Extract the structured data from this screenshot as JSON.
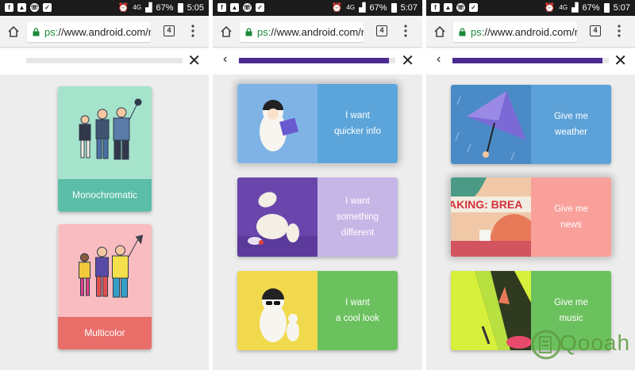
{
  "screens": [
    {
      "status": {
        "icons": [
          "facebook-icon",
          "gallery-icon",
          "whatsapp-icon",
          "clipboard-icon"
        ],
        "network": "4G",
        "battery": "67%",
        "time": "5:05"
      },
      "browser": {
        "scheme": "ps:",
        "url": "//www.android.com/r",
        "tabs": "4"
      },
      "progress": 0.0,
      "show_back": false,
      "cards": [
        {
          "label": "Monochromatic",
          "label_color": "#5bbea8",
          "art_color": "#a6e3cc"
        },
        {
          "label": "Multicolor",
          "label_color": "#e96e6a",
          "art_color": "#f8bcc1"
        }
      ]
    },
    {
      "status": {
        "icons": [
          "facebook-icon",
          "gallery-icon",
          "whatsapp-icon",
          "clipboard-icon"
        ],
        "network": "4G",
        "battery": "67%",
        "time": "5:07"
      },
      "browser": {
        "scheme": "ps:",
        "url": "//www.android.com/r",
        "tabs": "4"
      },
      "progress": 0.96,
      "show_back": true,
      "cards": [
        {
          "label_lines": [
            "I want",
            "quicker info"
          ],
          "label_color": "#5ca5da",
          "art_color": "#7fb3e6",
          "selected": true
        },
        {
          "label_lines": [
            "I want",
            "something",
            "different"
          ],
          "label_color": "#c6b6e6",
          "art_color": "#6a46ac"
        },
        {
          "label_lines": [
            "I want",
            "a cool look"
          ],
          "label_color": "#6cc15f",
          "art_color": "#f0d94c"
        }
      ]
    },
    {
      "status": {
        "icons": [
          "facebook-icon",
          "gallery-icon",
          "whatsapp-icon",
          "clipboard-icon"
        ],
        "network": "4G",
        "battery": "67%",
        "time": "5:07"
      },
      "browser": {
        "scheme": "ps:",
        "url": "//www.android.com/r",
        "tabs": "4"
      },
      "progress": 0.96,
      "show_back": true,
      "cards": [
        {
          "label_lines": [
            "Give me",
            "weather"
          ],
          "label_color": "#5ca2d8",
          "art_color": "#4a8bc7"
        },
        {
          "label_lines": [
            "Give me",
            "news"
          ],
          "label_color": "#f9a09a",
          "art_color": "#ef8a8f",
          "selected": true,
          "headline": "AKING: BREA"
        },
        {
          "label_lines": [
            "Give me",
            "music"
          ],
          "label_color": "#6cc15f",
          "art_color": "#2f3a20"
        }
      ]
    }
  ],
  "watermark": {
    "text": "Qooah",
    "color": "#5c9a3e"
  }
}
